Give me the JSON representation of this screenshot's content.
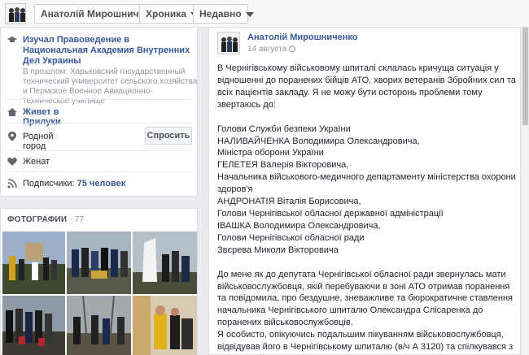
{
  "topbar": {
    "name_button": "Анатолій Мирошниченко",
    "chronicle_button": "Хроника",
    "recent_button": "Недавно"
  },
  "about": {
    "education_title": "Изучал Правоведение в Национальная Академия Внутренних Дел Украины",
    "education_previous": "В прошлом: Харьковский государственный технический университет сельского хозяйства и Пермское Военное Авиационно-техническое училище",
    "lives_in": "Живет в Прилуки",
    "hometown": "Родной город",
    "ask_button": "Спросить",
    "relationship": "Женат",
    "followers_label": "Подписчики:",
    "followers_value": "75 человек"
  },
  "photos": {
    "title": "ФОТОГРАФИИ",
    "separator": "·",
    "count": "77"
  },
  "post": {
    "author": "Анатолій Мирошниченко",
    "date": "14 августа",
    "paragraph1": "В Чернігівському військовому шпиталі склалась кричуща ситуація у відношенні до поранених бійців АТО, хворих ветеранів Збройних сил та всіх пацієнтів закладу. Я не можу бути осторонь проблеми тому звертаюсь до:",
    "recipients": [
      "Голови Служби безпеки України",
      "НАЛИВАЙЧЕНКА Володимира Олександровича,",
      "Міністра оборони України",
      "ГЕЛЕТЕЯ Валерія Вікторовича,",
      "Начальника військового-медичного департаменту міністерства охорони здоров'я",
      "АНДРОНАТІЯ Віталія Борисовича,",
      "Голови Чернігівської обласної державної адміністрації",
      "ІВАШКА Володимира Олександровича,",
      "Голови Чернігівської обласної ради",
      "Звєрева Миколи Вікторовича"
    ],
    "paragraph2": "До мене як до депутата Чернігівської обласної ради звернулась мати військовослужбовця, якій перебуваючи в зоні АТО отримав поранення та повідомила, про бездушне, зневажливе та бюрократичне ставлення начальника Чернігівського шпиталю Олександра Слісаренка до поранених військовослужбовців.",
    "paragraph3": "Я особисто, опікуючись подальшим пікуванням військовослужбовця, відвідував його в Чернігівському шпиталю (в/ч А 3120) та спілкувався з ним після його поступової виписки."
  }
}
